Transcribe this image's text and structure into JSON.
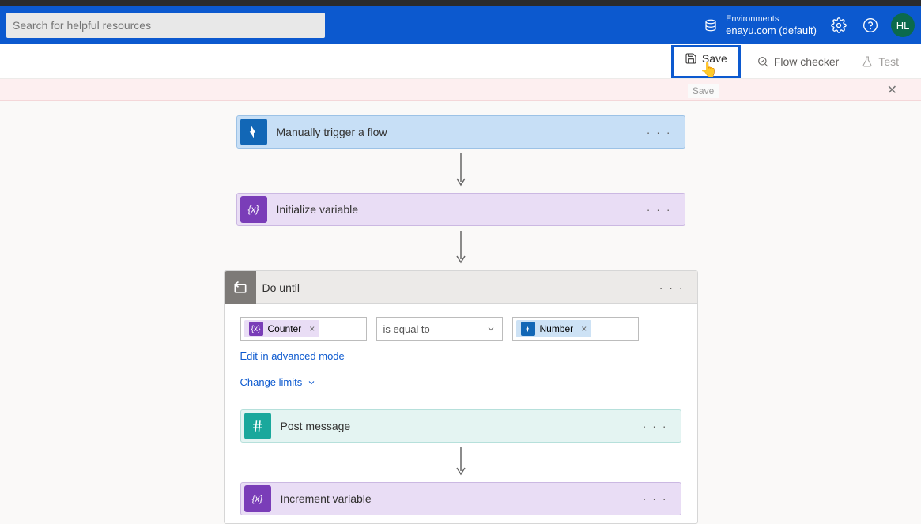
{
  "header": {
    "search_placeholder": "Search for helpful resources",
    "env_label": "Environments",
    "env_name": "enayu.com (default)",
    "avatar": "HL"
  },
  "toolbar": {
    "save": "Save",
    "checker": "Flow checker",
    "test": "Test",
    "save_tooltip": "Save"
  },
  "cards": {
    "trigger": "Manually trigger a flow",
    "init_var": "Initialize variable",
    "do_until": "Do until",
    "post_message": "Post message",
    "increment": "Increment variable"
  },
  "condition": {
    "left_token": "Counter",
    "operator": "is equal to",
    "right_token": "Number",
    "advanced_link": "Edit in advanced mode",
    "limits_link": "Change limits"
  },
  "icons": {
    "variable_glyph": "{x}",
    "pointer_glyph": "👆"
  }
}
